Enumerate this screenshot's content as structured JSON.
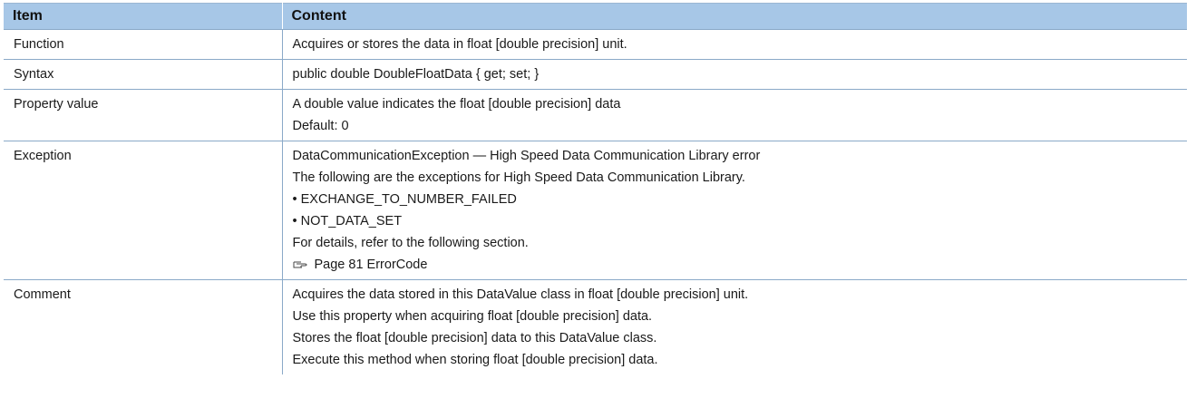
{
  "header": {
    "item": "Item",
    "content": "Content"
  },
  "rows": [
    {
      "item": "Function",
      "lines": [
        "Acquires or stores the data in float [double precision] unit."
      ]
    },
    {
      "item": "Syntax",
      "lines": [
        "public double DoubleFloatData { get; set; }"
      ]
    },
    {
      "item": "Property value",
      "lines": [
        "A double value indicates the float [double precision] data",
        "Default: 0"
      ]
    },
    {
      "item": "Exception",
      "lines": [
        "DataCommunicationException — High Speed Data Communication Library error",
        "The following are the exceptions for High Speed Data Communication Library.",
        "• EXCHANGE_TO_NUMBER_FAILED",
        "• NOT_DATA_SET",
        "For details, refer to the following section."
      ],
      "reference": {
        "icon": "pointing-hand-icon",
        "text": "Page 81 ErrorCode"
      }
    },
    {
      "item": "Comment",
      "lines": [
        "Acquires the data stored in this DataValue class in float [double precision] unit.",
        "Use this property when acquiring float [double precision] data.",
        "Stores the float [double precision] data to this DataValue class.",
        "Execute this method when storing float [double precision] data."
      ]
    }
  ]
}
